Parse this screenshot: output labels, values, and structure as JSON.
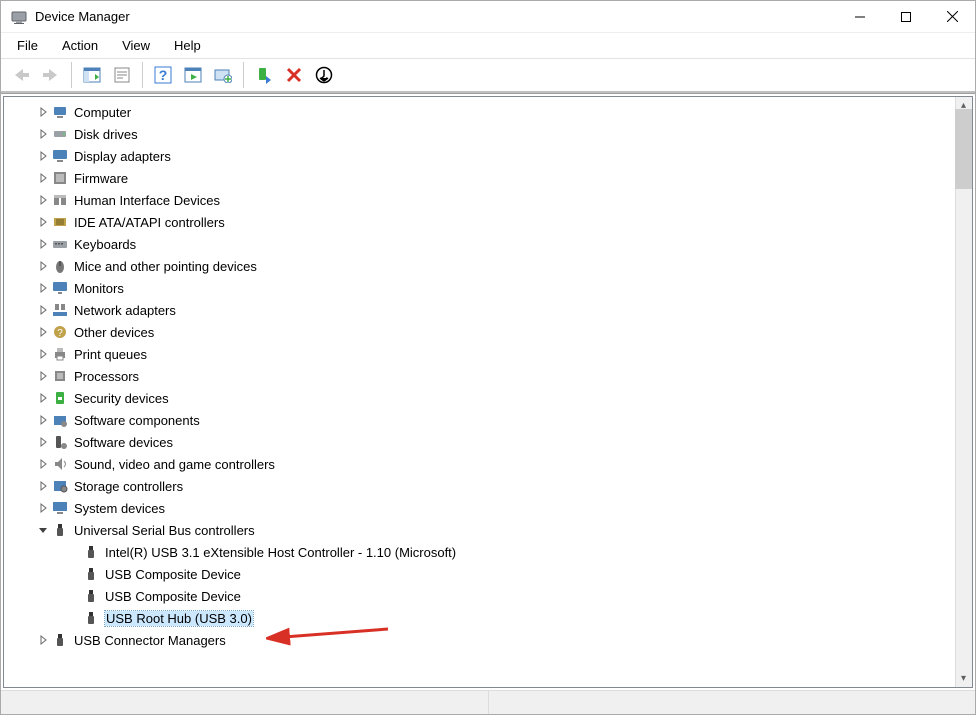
{
  "window": {
    "title": "Device Manager"
  },
  "menu": {
    "file": "File",
    "action": "Action",
    "view": "View",
    "help": "Help"
  },
  "tree": {
    "items": [
      {
        "label": "Computer",
        "icon": "computer-icon",
        "expanded": false
      },
      {
        "label": "Disk drives",
        "icon": "disk-icon",
        "expanded": false
      },
      {
        "label": "Display adapters",
        "icon": "display-icon",
        "expanded": false
      },
      {
        "label": "Firmware",
        "icon": "firmware-icon",
        "expanded": false
      },
      {
        "label": "Human Interface Devices",
        "icon": "hid-icon",
        "expanded": false
      },
      {
        "label": "IDE ATA/ATAPI controllers",
        "icon": "ide-icon",
        "expanded": false
      },
      {
        "label": "Keyboards",
        "icon": "keyboard-icon",
        "expanded": false
      },
      {
        "label": "Mice and other pointing devices",
        "icon": "mouse-icon",
        "expanded": false
      },
      {
        "label": "Monitors",
        "icon": "monitor-icon",
        "expanded": false
      },
      {
        "label": "Network adapters",
        "icon": "network-icon",
        "expanded": false
      },
      {
        "label": "Other devices",
        "icon": "other-icon",
        "expanded": false
      },
      {
        "label": "Print queues",
        "icon": "printer-icon",
        "expanded": false
      },
      {
        "label": "Processors",
        "icon": "cpu-icon",
        "expanded": false
      },
      {
        "label": "Security devices",
        "icon": "security-icon",
        "expanded": false
      },
      {
        "label": "Software components",
        "icon": "software-comp-icon",
        "expanded": false
      },
      {
        "label": "Software devices",
        "icon": "software-dev-icon",
        "expanded": false
      },
      {
        "label": "Sound, video and game controllers",
        "icon": "sound-icon",
        "expanded": false
      },
      {
        "label": "Storage controllers",
        "icon": "storage-icon",
        "expanded": false
      },
      {
        "label": "System devices",
        "icon": "system-icon",
        "expanded": false
      },
      {
        "label": "Universal Serial Bus controllers",
        "icon": "usb-icon",
        "expanded": true,
        "children": [
          {
            "label": "Intel(R) USB 3.1 eXtensible Host Controller - 1.10 (Microsoft)",
            "icon": "usb-icon"
          },
          {
            "label": "USB Composite Device",
            "icon": "usb-icon"
          },
          {
            "label": "USB Composite Device",
            "icon": "usb-icon"
          },
          {
            "label": "USB Root Hub (USB 3.0)",
            "icon": "usb-icon",
            "selected": true
          }
        ]
      },
      {
        "label": "USB Connector Managers",
        "icon": "usb-icon",
        "expanded": false
      }
    ]
  }
}
